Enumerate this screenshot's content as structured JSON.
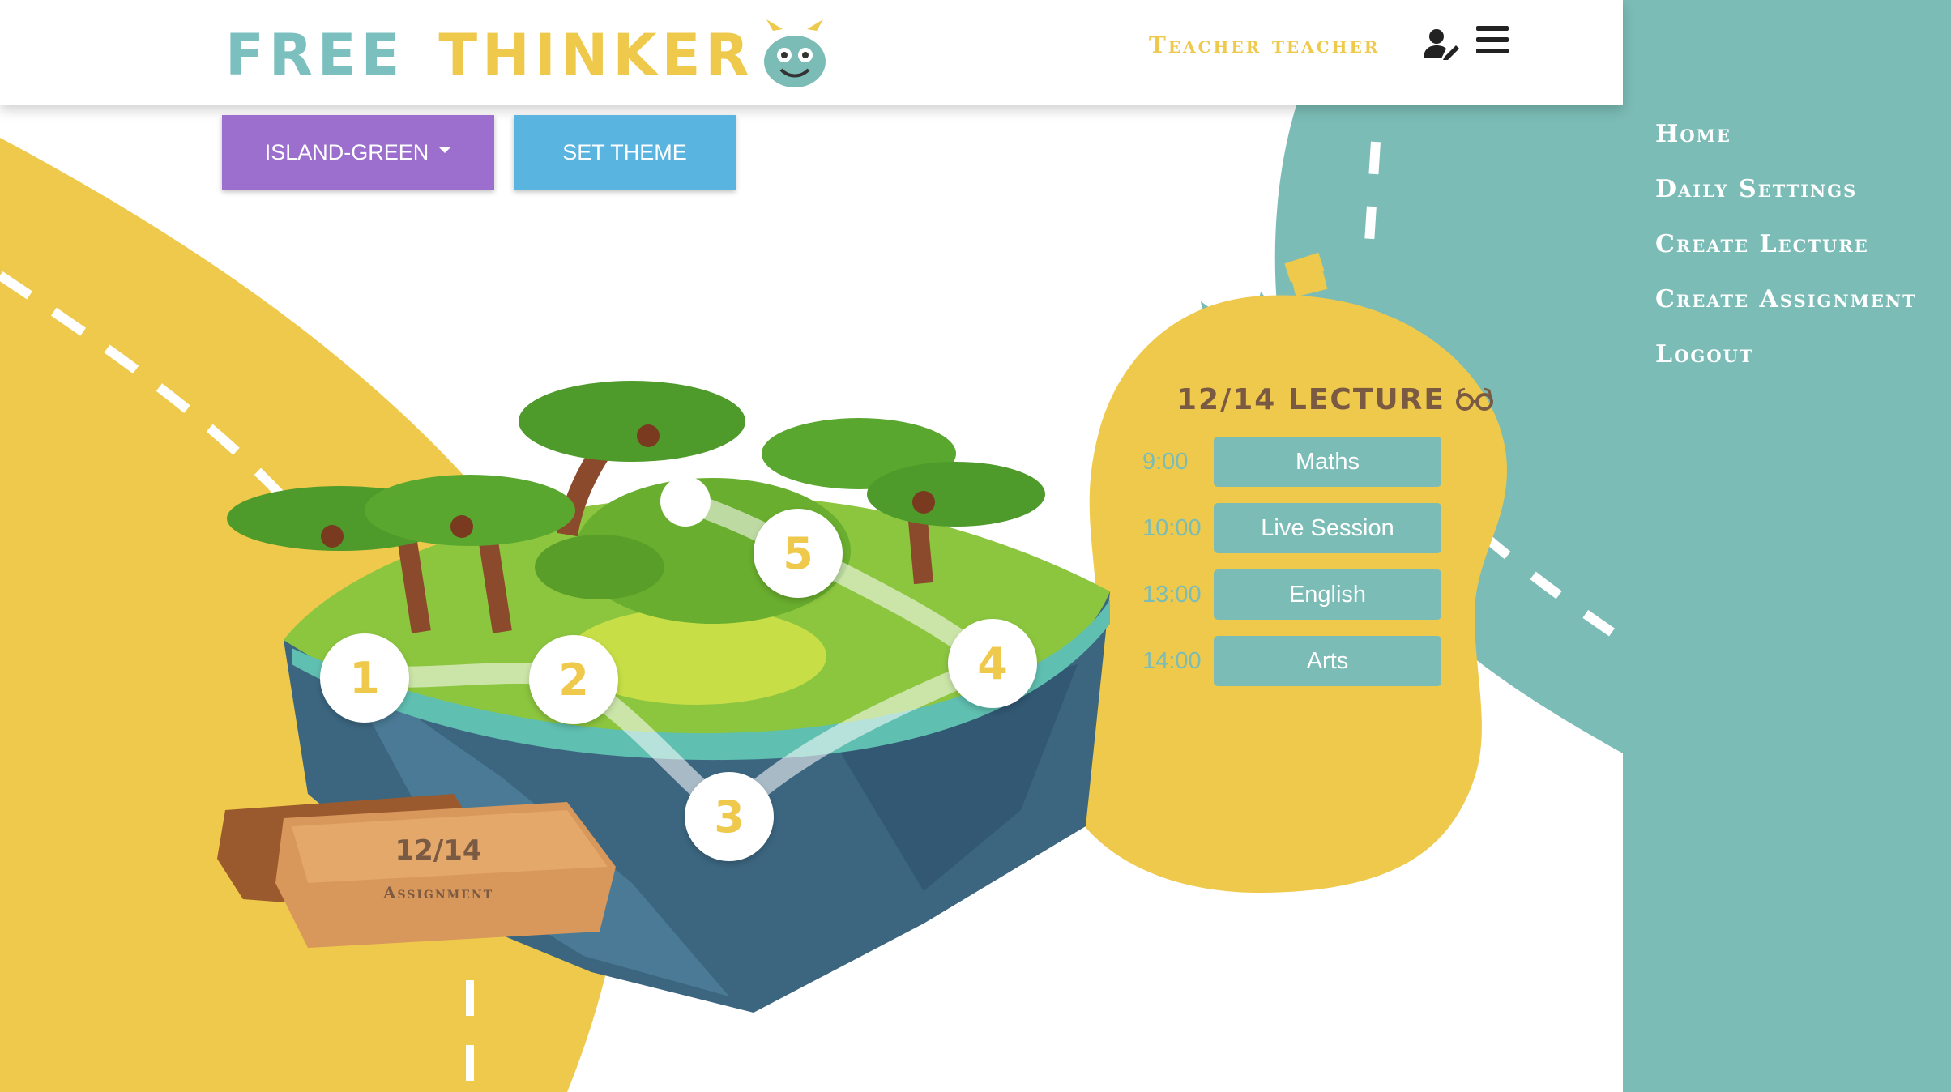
{
  "header": {
    "logo_word1": "FREE",
    "logo_word2": "THINKER",
    "user_name": "Teacher teacher"
  },
  "theme": {
    "selected": "ISLAND-GREEN",
    "set_label": "SET THEME"
  },
  "sidebar": {
    "items": [
      {
        "label": "Home"
      },
      {
        "label": "Daily Settings"
      },
      {
        "label": "Create Lecture"
      },
      {
        "label": "Create Assignment"
      },
      {
        "label": "Logout"
      }
    ]
  },
  "island": {
    "nodes": [
      "1",
      "2",
      "3",
      "4",
      "5"
    ]
  },
  "assignment": {
    "date": "12/14",
    "label": "Assignment"
  },
  "lecture": {
    "title": "12/14 LECTURE",
    "schedule": [
      {
        "time": "9:00",
        "subject": "Maths"
      },
      {
        "time": "10:00",
        "subject": "Live Session"
      },
      {
        "time": "13:00",
        "subject": "English"
      },
      {
        "time": "14:00",
        "subject": "Arts"
      }
    ]
  },
  "colors": {
    "yellow": "#eec94c",
    "teal": "#7bbcb6",
    "purple": "#9c6fcf",
    "blue": "#5ab4e0",
    "brown_text": "#7b5a43"
  },
  "icons": {
    "user": "user-edit-icon",
    "menu": "hamburger-menu-icon",
    "lecture": "glasses-icon",
    "mascot": "monster-mascot-icon"
  }
}
